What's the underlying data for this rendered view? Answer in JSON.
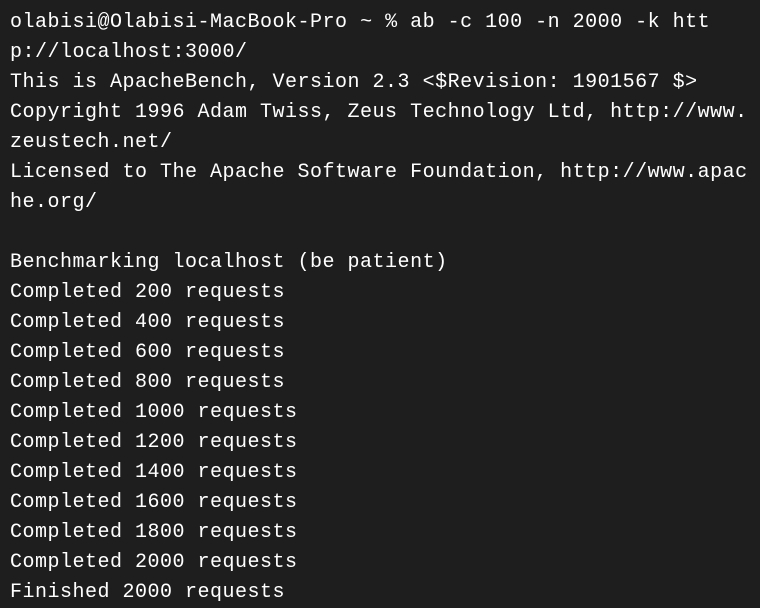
{
  "prompt": {
    "user_host": "olabisi@Olabisi-MacBook-Pro",
    "path": "~",
    "symbol": "%",
    "command": "ab -c 100 -n 2000 -k http://localhost:3000/"
  },
  "header": {
    "line1": "This is ApacheBench, Version 2.3 <$Revision: 1901567 $>",
    "line2": "Copyright 1996 Adam Twiss, Zeus Technology Ltd, http://www.zeustech.net/",
    "line3": "Licensed to The Apache Software Foundation, http://www.apache.org/"
  },
  "benchmark": {
    "intro": "Benchmarking localhost (be patient)",
    "progress": [
      "Completed 200 requests",
      "Completed 400 requests",
      "Completed 600 requests",
      "Completed 800 requests",
      "Completed 1000 requests",
      "Completed 1200 requests",
      "Completed 1400 requests",
      "Completed 1600 requests",
      "Completed 1800 requests",
      "Completed 2000 requests"
    ],
    "finished": "Finished 2000 requests"
  }
}
